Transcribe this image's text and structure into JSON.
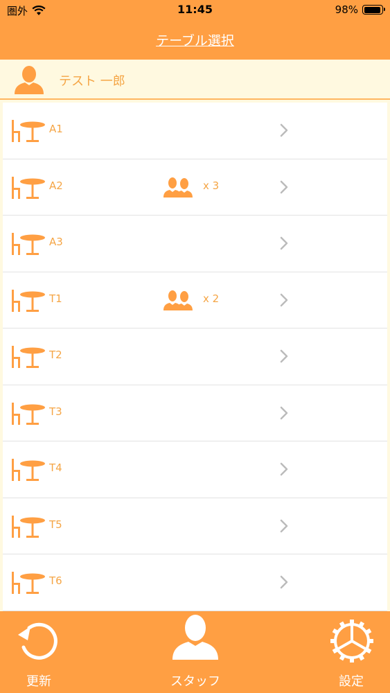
{
  "status_bar": {
    "carrier": "圏外",
    "time": "11:45",
    "battery_percent": "98%",
    "battery_level": 0.98,
    "icons": [
      "wifi-icon",
      "battery-icon"
    ]
  },
  "nav": {
    "title": "テーブル選択"
  },
  "user": {
    "name": "テスト 一郎",
    "icon": "person-icon"
  },
  "tables": [
    {
      "label": "A1",
      "guests": ""
    },
    {
      "label": "A2",
      "guests": "x 3"
    },
    {
      "label": "A3",
      "guests": ""
    },
    {
      "label": "T1",
      "guests": "x 2"
    },
    {
      "label": "T2",
      "guests": ""
    },
    {
      "label": "T3",
      "guests": ""
    },
    {
      "label": "T4",
      "guests": ""
    },
    {
      "label": "T5",
      "guests": ""
    },
    {
      "label": "T6",
      "guests": ""
    }
  ],
  "tabbar": {
    "refresh_label": "更新",
    "staff_label": "スタッフ",
    "settings_label": "設定"
  },
  "colors": {
    "accent": "#ff9f43",
    "text_accent": "#f5a545",
    "user_row_bg": "#fff9e0",
    "chevron": "#bbbbbb"
  }
}
